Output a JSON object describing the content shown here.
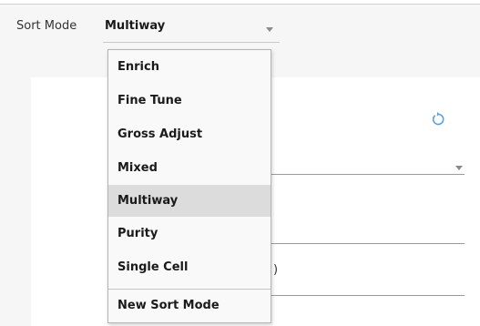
{
  "sort_mode": {
    "label": "Sort Mode",
    "value": "Multiway"
  },
  "dropdown": {
    "items": [
      {
        "label": "Enrich"
      },
      {
        "label": "Fine Tune"
      },
      {
        "label": "Gross Adjust"
      },
      {
        "label": "Mixed"
      },
      {
        "label": "Multiway",
        "selected": true
      },
      {
        "label": "Purity"
      },
      {
        "label": "Single Cell"
      }
    ],
    "footer_item": "New Sort Mode"
  },
  "background": {
    "partial_text": ")"
  },
  "icons": {
    "refresh": "refresh-icon",
    "caret": "chevron-down-icon"
  },
  "colors": {
    "accent": "#5aa0dc",
    "selected_bg": "#dcdcdc"
  }
}
